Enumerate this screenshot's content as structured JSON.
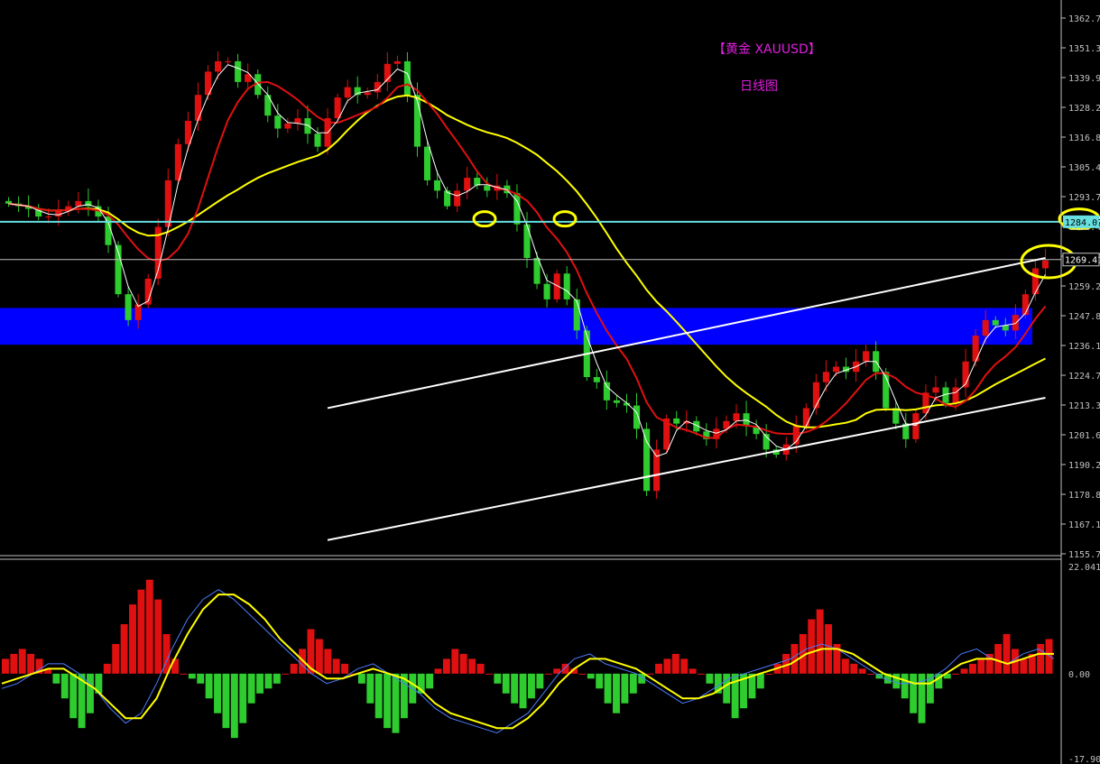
{
  "header": {
    "title": "【黄金 XAUUSD】",
    "subtitle": "日线图"
  },
  "colors": {
    "background": "#000000",
    "bull_candle": "#e01010",
    "bear_candle": "#2ecc2e",
    "ma_fast": "#ffffff",
    "ma_mid": "#e01010",
    "ma_slow": "#ffff00",
    "support_zone": "#0000ff",
    "horizontal_line": "#66e0e0",
    "price_line": "#c0c0c0",
    "channel": "#ffffff",
    "annotation": "#ffff00",
    "macd_pos": "#e01010",
    "macd_neg": "#2ecc2e",
    "signal": "#ffff00",
    "macd_line": "#4a7cff",
    "axis_text": "#c0c0c0"
  },
  "chart_data": [
    {
      "type": "candlestick",
      "title": "",
      "yaxis_ticks": [
        "1362.70",
        "1351.30",
        "1339.90",
        "1328.20",
        "1316.80",
        "1305.40",
        "1293.70",
        "1282.40",
        "1270.70",
        "1259.20",
        "1247.80",
        "1236.10",
        "1224.70",
        "1213.30",
        "1201.60",
        "1190.20",
        "1178.80",
        "1167.10",
        "1155.70"
      ],
      "ylim": [
        1155.7,
        1362.7
      ],
      "price_label": "1269.41",
      "level_label": "1284.01",
      "level_value": 1284.0,
      "current_price": 1269.4,
      "support_zone": [
        1236.5,
        1250.7
      ],
      "trend_channel": {
        "upper": [
          [
            0,
            1212
          ],
          [
            72,
            1270
          ]
        ],
        "lower": [
          [
            0,
            1161
          ],
          [
            72,
            1216
          ]
        ]
      },
      "marked_points": [
        [
          0.1,
          1285.1
        ],
        [
          0.2,
          1285.1
        ],
        [
          0.3,
          1285.1
        ],
        [
          0.4,
          1268.6
        ]
      ],
      "close_path": [
        1291,
        1290,
        1289,
        1286,
        1286,
        1288,
        1290,
        1292,
        1290,
        1286,
        1275,
        1256,
        1246,
        1252,
        1262,
        1282,
        1300,
        1314,
        1323,
        1333,
        1342,
        1346,
        1346,
        1338,
        1341,
        1333,
        1325,
        1320,
        1322,
        1324,
        1318,
        1313,
        1324,
        1332,
        1336,
        1333,
        1334,
        1338,
        1345,
        1346,
        1333,
        1313,
        1300,
        1296,
        1290,
        1296,
        1301,
        1298,
        1296,
        1298,
        1295,
        1283,
        1270,
        1260,
        1254,
        1264,
        1254,
        1242,
        1224,
        1222,
        1215,
        1214,
        1213,
        1204,
        1180,
        1196,
        1208,
        1206,
        1207,
        1203,
        1200,
        1204,
        1207,
        1210,
        1205,
        1202,
        1196,
        1194,
        1198,
        1205,
        1212,
        1222,
        1226,
        1228,
        1226,
        1230,
        1234,
        1226,
        1212,
        1206,
        1200,
        1210,
        1218,
        1220,
        1214,
        1220,
        1230,
        1240,
        1246,
        1244,
        1242,
        1248,
        1256,
        1266,
        1269
      ]
    },
    {
      "type": "bar",
      "title": "",
      "yaxis_ticks": [
        "22.0416",
        "0.00",
        "-17.9016"
      ],
      "ylim": [
        -17.9016,
        22.0416
      ],
      "histogram": [
        3,
        4,
        5,
        4,
        3,
        1,
        -2,
        -5,
        -9,
        -11,
        -8,
        -4,
        2,
        6,
        10,
        14,
        17,
        19,
        15,
        8,
        3,
        0,
        -1,
        -2,
        -5,
        -8,
        -11,
        -13,
        -10,
        -6,
        -4,
        -3,
        -2,
        0,
        2,
        5,
        9,
        7,
        5,
        3,
        2,
        0,
        -2,
        -6,
        -9,
        -11,
        -12,
        -9,
        -6,
        -4,
        -3,
        1,
        3,
        5,
        4,
        3,
        2,
        0,
        -2,
        -4,
        -6,
        -7,
        -5,
        -3,
        0,
        1,
        2,
        1,
        0,
        -1,
        -3,
        -6,
        -8,
        -6,
        -4,
        -2,
        0,
        2,
        3,
        4,
        3,
        1,
        0,
        -2,
        -4,
        -6,
        -9,
        -7,
        -5,
        -3,
        0,
        2,
        4,
        6,
        8,
        11,
        13,
        10,
        6,
        3,
        2,
        1,
        0,
        -1,
        -2,
        -3,
        -5,
        -8,
        -10,
        -6,
        -3,
        -1,
        0,
        1,
        2,
        3,
        4,
        6,
        8,
        5,
        3,
        4,
        6,
        7
      ],
      "series": [
        {
          "name": "",
          "values": [
            -3,
            -2,
            0,
            2,
            2,
            0,
            -3,
            -7,
            -10,
            -8,
            -2,
            5,
            11,
            15,
            17,
            15,
            12,
            9,
            6,
            3,
            0,
            -2,
            -1,
            1,
            2,
            0,
            -2,
            -4,
            -7,
            -9,
            -10,
            -11,
            -12,
            -10,
            -8,
            -4,
            0,
            3,
            4,
            2,
            1,
            0,
            -2,
            -4,
            -6,
            -5,
            -3,
            -1,
            0,
            1,
            2,
            3,
            5,
            6,
            5,
            3,
            1,
            -1,
            -2,
            -2,
            -1,
            1,
            4,
            5,
            3,
            2,
            4,
            5,
            3
          ]
        },
        {
          "name": "",
          "values": [
            -2,
            -1,
            0,
            1,
            1,
            -1,
            -3,
            -6,
            -9,
            -9,
            -5,
            2,
            8,
            13,
            16,
            16,
            14,
            11,
            7,
            4,
            1,
            -1,
            -1,
            0,
            1,
            0,
            -1,
            -3,
            -6,
            -8,
            -9,
            -10,
            -11,
            -11,
            -9,
            -6,
            -2,
            1,
            3,
            3,
            2,
            1,
            -1,
            -3,
            -5,
            -5,
            -4,
            -2,
            -1,
            0,
            1,
            2,
            4,
            5,
            5,
            4,
            2,
            0,
            -1,
            -2,
            -2,
            0,
            2,
            3,
            3,
            2,
            3,
            4,
            4
          ]
        }
      ]
    }
  ]
}
